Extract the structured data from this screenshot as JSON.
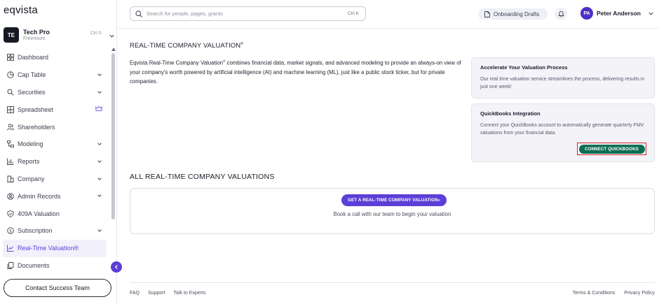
{
  "app": {
    "logo": "eqvista"
  },
  "account": {
    "initials": "TE",
    "name": "Tech Pro",
    "plan": "Freemium",
    "shortcut": "Ctrl O"
  },
  "sidebar": {
    "items": [
      {
        "label": "Dashboard",
        "icon": "dashboard-icon",
        "chevron": false
      },
      {
        "label": "Cap Table",
        "icon": "pie-chart-icon",
        "chevron": true
      },
      {
        "label": "Securities",
        "icon": "securities-icon",
        "chevron": true
      },
      {
        "label": "Spreadsheet",
        "icon": "grid-icon",
        "crown": true
      },
      {
        "label": "Shareholders",
        "icon": "users-icon",
        "chevron": false
      },
      {
        "label": "Modeling",
        "icon": "modeling-icon",
        "chevron": true
      },
      {
        "label": "Reports",
        "icon": "reports-icon",
        "chevron": true
      },
      {
        "label": "Company",
        "icon": "company-icon",
        "chevron": true
      },
      {
        "label": "Admin Records",
        "icon": "admin-records-icon",
        "chevron": true
      },
      {
        "label": "409A Valuation",
        "icon": "shield-check-icon",
        "chevron": false
      },
      {
        "label": "Subscription",
        "icon": "subscription-icon",
        "chevron": true
      },
      {
        "label": "Real-Time Valuation®",
        "icon": "line-chart-icon",
        "active": true
      },
      {
        "label": "Documents",
        "icon": "documents-icon",
        "chevron": false
      }
    ],
    "contact_label": "Contact Success Team"
  },
  "header": {
    "search_placeholder": "Search for people, pages, grants",
    "search_shortcut": "Ctrl K",
    "drafts_label": "Onboarding Drafts",
    "user_initials": "PA",
    "user_name": "Peter Anderson"
  },
  "main": {
    "title": "REAL-TIME COMPANY VALUATION",
    "title_mark": "®",
    "intro_pre": "Eqvista Real-Time Company Valuation",
    "intro_mark": "®",
    "intro_post": " combines financial data, market signals, and advanced modeling to provide an always-on view of your company's worth powered by artificial intelligence (AI) and machine learning (ML), just like a public stock ticker, but for private companies.",
    "card_accelerate": {
      "title": "Accelerate Your Valuation Process",
      "body": "Our real time valuation service streamlines the process, delivering results in just one week!"
    },
    "card_quickbooks": {
      "title": "QuickBooks Integration",
      "body": "Connect your QuickBooks account to automatically generate quarterly FMV valuations from your financial data.",
      "button": "CONNECT QUICKBOOKS"
    },
    "section_title": "ALL REAL-TIME COMPANY VALUATIONS",
    "cta_label": "GET A REAL-TIME COMPANY VALUATION",
    "cta_mark": "®",
    "cta_sub": "Book a call with our team to begin your valuation"
  },
  "footer": {
    "left": [
      "FAQ",
      "Support",
      "Talk to Experts"
    ],
    "right": [
      "Terms & Conditions",
      "Privacy Policy"
    ]
  },
  "colors": {
    "accent": "#5b3fd6",
    "quickbooks": "#0f6e52",
    "highlight": "#d6232f"
  }
}
